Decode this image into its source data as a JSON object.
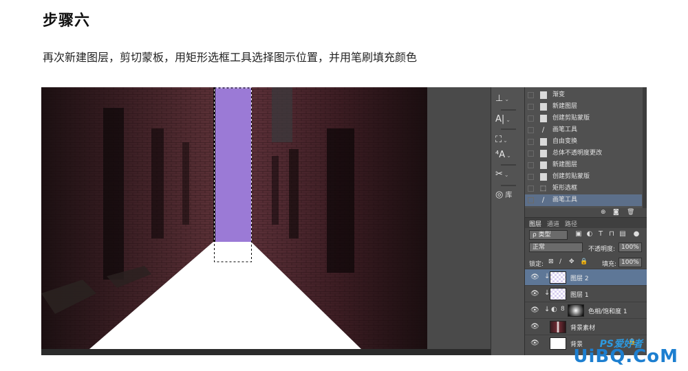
{
  "article": {
    "step_title": "步骤六",
    "instruction": "再次新建图层，剪切蒙板，用矩形选框工具选择图示位置，并用笔刷填充颜色"
  },
  "tools": [
    {
      "icon": "stamp-tool-icon",
      "glyph": "⊥",
      "label": ""
    },
    {
      "icon": "type-tool-icon",
      "glyph": "A|",
      "label": ""
    },
    {
      "icon": "paint-bucket-icon",
      "glyph": "⛶",
      "label": ""
    },
    {
      "icon": "character-icon",
      "glyph": "⁴A",
      "label": ""
    },
    {
      "icon": "scissors-icon",
      "glyph": "✂",
      "label": ""
    },
    {
      "icon": "library-icon",
      "glyph": "◎",
      "label": "库"
    }
  ],
  "history": [
    {
      "label": "渐变",
      "icon": "doc"
    },
    {
      "label": "新建图层",
      "icon": "doc"
    },
    {
      "label": "创建剪贴蒙版",
      "icon": "doc"
    },
    {
      "label": "画笔工具",
      "icon": "brush"
    },
    {
      "label": "自由变换",
      "icon": "doc"
    },
    {
      "label": "总体不透明度更改",
      "icon": "doc"
    },
    {
      "label": "新建图层",
      "icon": "doc"
    },
    {
      "label": "创建剪贴蒙版",
      "icon": "doc"
    },
    {
      "label": "矩形选框",
      "icon": "marquee"
    },
    {
      "label": "画笔工具",
      "icon": "brush",
      "selected": true
    }
  ],
  "layers_panel": {
    "tabs": [
      "图层",
      "通道",
      "路径"
    ],
    "filter_kind": "ρ 类型",
    "blend_mode": "正常",
    "opacity_label": "不透明度:",
    "opacity_value": "100%",
    "lock_label": "锁定:",
    "fill_label": "填充:",
    "fill_value": "100%",
    "layers": [
      {
        "name": "图层 2",
        "thumb": "checker",
        "clipped": true,
        "selected": true
      },
      {
        "name": "图层 1",
        "thumb": "checker",
        "clipped": true
      },
      {
        "name": "色相/饱和度 1",
        "thumb": "mask",
        "clipped": true,
        "adjustment": true
      },
      {
        "name": "背景素材",
        "thumb": "photo"
      },
      {
        "name": "背景",
        "thumb": "white",
        "locked": true
      }
    ]
  },
  "colors": {
    "selection_fill": "#9b7ad6",
    "road": "#ffffff",
    "ui_dark": "#4b4b4b",
    "layer_selected": "#5e7797"
  },
  "watermark": {
    "main": "UiBQ.CoM",
    "sub": "PS爱好者"
  }
}
